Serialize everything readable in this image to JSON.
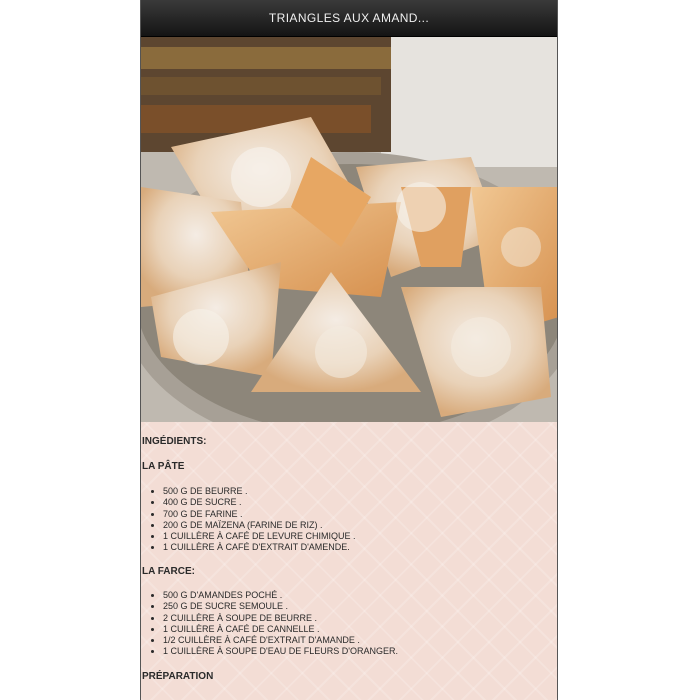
{
  "header": {
    "title": "TRIANGLES AUX AMAND..."
  },
  "hero": {
    "icon": "pastry-photo"
  },
  "ingredients": {
    "heading": "INGÉDIENTS:",
    "pate": {
      "heading": "LA PÂTE",
      "items": [
        "500 G DE BEURRE .",
        "400 G DE SUCRE .",
        "700 G DE FARINE .",
        "200 G DE MAÏZENA (FARINE DE RIZ) .",
        "1 CUILLÈRE À CAFÉ DE LEVURE CHIMIQUE .",
        "1 CUILLÈRE À CAFÉ D'EXTRAIT D'AMENDE."
      ]
    },
    "farce": {
      "heading": "LA FARCE:",
      "items": [
        "500 G D'AMANDES POCHÉ .",
        "250 G DE SUCRE SEMOULE .",
        "2 CUILLÈRE À SOUPE DE BEURRE .",
        "1 CUILLÈRE À CAFÉ DE CANNELLE .",
        "1/2 CUILLÈRE À CAFÉ D'EXTRAIT D'AMANDE .",
        "1 CUILLÈRE À SOUPE D'EAU DE FLEURS D'ORANGER."
      ]
    }
  },
  "preparation": {
    "heading": "PRÉPARATION"
  }
}
